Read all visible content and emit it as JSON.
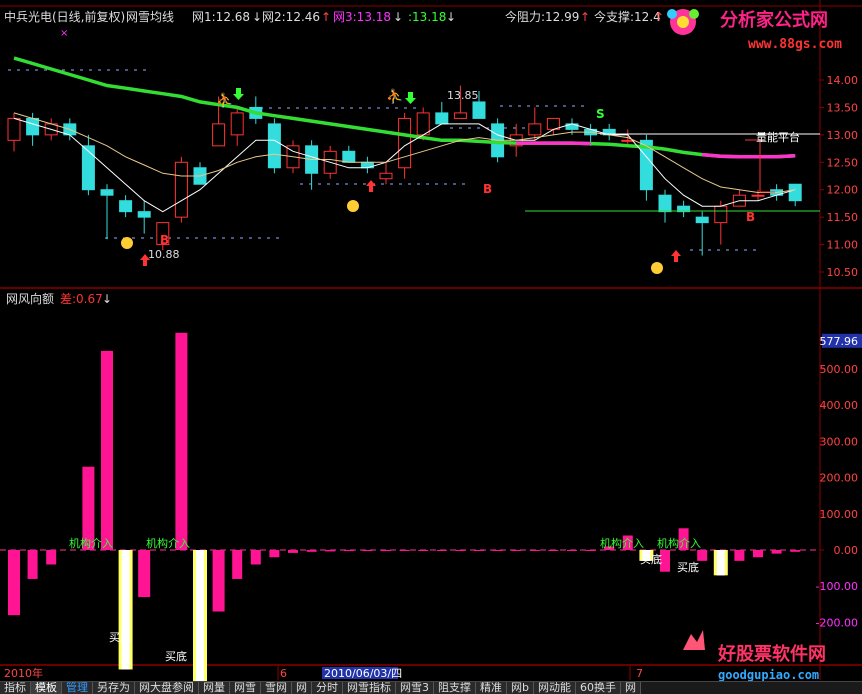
{
  "header": {
    "stock": "中兵光电(日线,前复权)",
    "indicator": "网雪均线",
    "w1": "网1:12.68",
    "w1_arrow": "↓",
    "w2": "网2:12.46",
    "w2_arrow": "↑",
    "w3": "网3:13.18",
    "w3_arrow": "↓",
    "w4": ":13.18",
    "w4_arrow": "↓",
    "resistance": "今阻力:12.99",
    "resistance_arrow": "↑",
    "support": "今支撑:12.4",
    "support_arrow": "↑"
  },
  "sub_header": {
    "name": "网风向额",
    "diff": "差:0.67",
    "diff_arrow": "↓"
  },
  "watermark_top": {
    "title": "分析家公式网",
    "url": "www.88gs.com"
  },
  "watermark_bottom": {
    "title": "好股票软件网",
    "url": "goodgupiao.com"
  },
  "price_axis": [
    "14.00",
    "13.50",
    "13.00",
    "12.50",
    "12.00",
    "11.50",
    "11.00",
    "10.50"
  ],
  "volume_axis": [
    "577.96",
    "500.00",
    "400.00",
    "300.00",
    "200.00",
    "100.00",
    "0.00",
    "-100.00",
    "-200.00"
  ],
  "date_labels": {
    "year": "2010年",
    "m6": "6",
    "sel_date": "2010/06/03/四",
    "m7": "7"
  },
  "annotations": {
    "high_label": "13.85",
    "low_label": "10.88",
    "platform": "量能平台",
    "jigou": "机构介入",
    "maidi": "买底",
    "B": "B",
    "S": "S"
  },
  "chart_data": [
    {
      "type": "candlestick",
      "title": "",
      "ylim": [
        10.2,
        14.3
      ],
      "ohlc": [
        [
          12.9,
          13.4,
          12.7,
          13.3
        ],
        [
          13.3,
          13.4,
          12.8,
          13.0
        ],
        [
          13.0,
          13.3,
          12.9,
          13.2
        ],
        [
          13.2,
          13.3,
          12.9,
          13.0
        ],
        [
          12.8,
          13.0,
          11.9,
          12.0
        ],
        [
          12.0,
          12.1,
          11.1,
          11.9
        ],
        [
          11.8,
          11.9,
          11.5,
          11.6
        ],
        [
          11.6,
          11.8,
          11.2,
          11.5
        ],
        [
          11.0,
          11.4,
          10.9,
          11.4
        ],
        [
          11.5,
          12.6,
          11.4,
          12.5
        ],
        [
          12.4,
          12.5,
          12.1,
          12.1
        ],
        [
          12.8,
          13.7,
          12.8,
          13.2
        ],
        [
          13.0,
          13.5,
          12.8,
          13.4
        ],
        [
          13.5,
          13.7,
          13.2,
          13.3
        ],
        [
          13.2,
          13.3,
          12.3,
          12.4
        ],
        [
          12.4,
          12.9,
          12.3,
          12.8
        ],
        [
          12.8,
          12.9,
          12.0,
          12.3
        ],
        [
          12.3,
          12.8,
          12.2,
          12.7
        ],
        [
          12.7,
          12.8,
          12.5,
          12.5
        ],
        [
          12.5,
          12.6,
          12.3,
          12.4
        ],
        [
          12.2,
          12.5,
          12.1,
          12.3
        ],
        [
          12.4,
          13.4,
          12.2,
          13.3
        ],
        [
          13.0,
          13.5,
          12.9,
          13.4
        ],
        [
          13.4,
          13.6,
          13.2,
          13.2
        ],
        [
          13.3,
          13.9,
          13.3,
          13.4
        ],
        [
          13.6,
          13.8,
          13.3,
          13.3
        ],
        [
          13.2,
          13.3,
          12.5,
          12.6
        ],
        [
          12.8,
          13.2,
          12.6,
          13.0
        ],
        [
          13.0,
          13.5,
          12.9,
          13.2
        ],
        [
          13.1,
          13.3,
          13.0,
          13.3
        ],
        [
          13.2,
          13.3,
          13.0,
          13.1
        ],
        [
          13.1,
          13.2,
          12.8,
          13.0
        ],
        [
          13.1,
          13.2,
          12.9,
          13.0
        ],
        [
          12.9,
          13.1,
          12.8,
          12.9
        ],
        [
          12.9,
          13.0,
          11.8,
          12.0
        ],
        [
          11.9,
          12.0,
          11.4,
          11.6
        ],
        [
          11.7,
          11.8,
          11.5,
          11.6
        ],
        [
          11.5,
          11.6,
          10.8,
          11.4
        ],
        [
          11.4,
          11.8,
          11.0,
          11.7
        ],
        [
          11.7,
          12.0,
          11.7,
          11.9
        ],
        [
          11.9,
          12.0,
          11.8,
          11.9
        ],
        [
          12.0,
          12.1,
          11.8,
          11.9
        ],
        [
          12.1,
          12.0,
          11.7,
          11.8
        ]
      ],
      "lines": [
        {
          "name": "网雪均线",
          "color": "#33dd33",
          "values": [
            14.4,
            14.3,
            14.2,
            14.1,
            14.0,
            13.9,
            13.85,
            13.8,
            13.75,
            13.7,
            13.6,
            13.55,
            13.5,
            13.4,
            13.35,
            13.3,
            13.25,
            13.2,
            13.15,
            13.1,
            13.05,
            13.0,
            12.95,
            12.9,
            12.9,
            12.88,
            12.86,
            12.85,
            12.85,
            12.85,
            12.85,
            12.84,
            12.83,
            12.8,
            12.78,
            12.74,
            12.68,
            12.64,
            12.61,
            12.6,
            12.6,
            12.6,
            12.62
          ]
        },
        {
          "name": "ma_short",
          "color": "#ffffff",
          "values": [
            13.3,
            13.2,
            13.1,
            13.0,
            12.7,
            12.4,
            12.1,
            11.8,
            11.6,
            11.8,
            12.0,
            12.3,
            12.6,
            12.9,
            12.9,
            12.7,
            12.6,
            12.5,
            12.4,
            12.4,
            12.5,
            12.8,
            13.0,
            13.2,
            13.2,
            13.2,
            13.0,
            12.9,
            12.9,
            13.1,
            13.2,
            13.1,
            13.0,
            13.0,
            12.6,
            12.2,
            11.9,
            11.7,
            11.7,
            11.8,
            11.8,
            11.9,
            12.0
          ]
        },
        {
          "name": "ma_long",
          "color": "#e8c98a",
          "values": [
            13.4,
            13.3,
            13.2,
            13.1,
            12.95,
            12.8,
            12.6,
            12.45,
            12.3,
            12.25,
            12.25,
            12.35,
            12.5,
            12.6,
            12.65,
            12.6,
            12.55,
            12.55,
            12.5,
            12.5,
            12.5,
            12.6,
            12.7,
            12.8,
            12.9,
            12.95,
            12.9,
            12.9,
            12.95,
            13.0,
            13.05,
            13.05,
            13.0,
            12.95,
            12.8,
            12.6,
            12.4,
            12.2,
            12.05,
            12.0,
            11.95,
            11.95,
            12.0
          ]
        }
      ]
    },
    {
      "type": "bar",
      "title": "",
      "ylim": [
        -250,
        630
      ],
      "values": [
        -180,
        -80,
        -40,
        0,
        230,
        550,
        -330,
        -130,
        0,
        600,
        -370,
        -170,
        -80,
        -40,
        -20,
        -8,
        -5,
        -4,
        -3,
        -3,
        -3,
        -2,
        -2,
        -2,
        -2,
        -2,
        -2,
        -2,
        -2,
        -2,
        -2,
        -2,
        10,
        40,
        -30,
        -60,
        60,
        -30,
        -70,
        -30,
        -20,
        -10,
        -5
      ]
    }
  ],
  "tabs": [
    "指标",
    "模板",
    "管理",
    "另存为",
    "网大盘参阅",
    "网量",
    "网雪",
    "雪网",
    "网",
    "分时",
    "网雪指标",
    "网雪3",
    "阻支撑",
    "精准",
    "网b",
    "网动能",
    "60换手",
    "网"
  ]
}
